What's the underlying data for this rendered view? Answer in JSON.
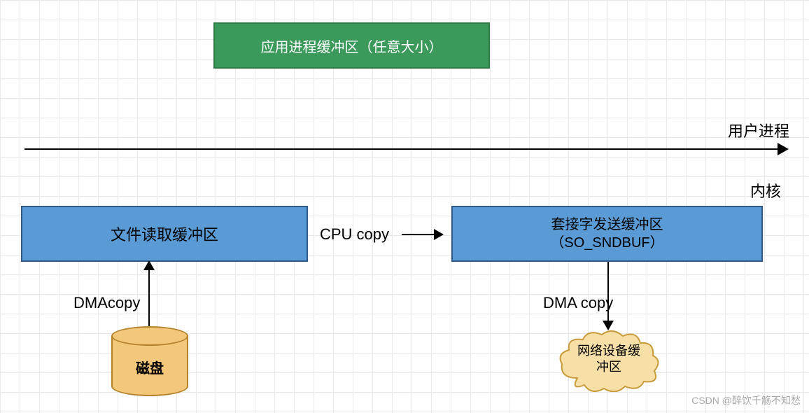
{
  "boxes": {
    "app_buffer": "应用进程缓冲区（任意大小）",
    "file_read_buffer": "文件读取缓冲区",
    "socket_send_buffer_line1": "套接字发送缓冲区",
    "socket_send_buffer_line2": "（SO_SNDBUF）"
  },
  "labels": {
    "user_process": "用户进程",
    "kernel": "内核",
    "cpu_copy": "CPU copy",
    "dma_copy_left": "DMAcopy",
    "dma_copy_right": "DMA copy"
  },
  "disk": {
    "label": "磁盘"
  },
  "cloud": {
    "line1": "网络设备缓",
    "line2": "冲区"
  },
  "watermark": "CSDN @醉饮千觞不知愁"
}
